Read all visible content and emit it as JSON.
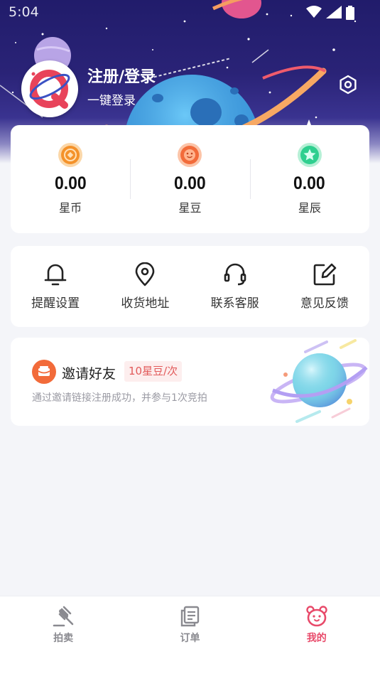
{
  "status_bar": {
    "time": "5:04"
  },
  "profile": {
    "title": "注册/登录",
    "subtitle": "一键登录"
  },
  "stats": [
    {
      "value": "0.00",
      "label": "星币",
      "icon": "coin-icon"
    },
    {
      "value": "0.00",
      "label": "星豆",
      "icon": "bean-icon"
    },
    {
      "value": "0.00",
      "label": "星辰",
      "icon": "star-icon"
    }
  ],
  "tools": [
    {
      "label": "提醒设置",
      "icon": "bell-icon"
    },
    {
      "label": "收货地址",
      "icon": "location-pin-icon"
    },
    {
      "label": "联系客服",
      "icon": "headset-icon"
    },
    {
      "label": "意见反馈",
      "icon": "edit-icon"
    }
  ],
  "invite": {
    "title": "邀请好友",
    "badge": "10星豆/次",
    "description": "通过邀请链接注册成功，并参与1次竞拍"
  },
  "bottom_nav": [
    {
      "label": "拍卖",
      "icon": "gavel-icon",
      "active": false
    },
    {
      "label": "订单",
      "icon": "document-icon",
      "active": false
    },
    {
      "label": "我的",
      "icon": "bear-icon",
      "active": true
    }
  ],
  "colors": {
    "accent": "#e84a6a",
    "banner_dark": "#211c6b",
    "coin": "#f4922a",
    "bean": "#f26b3a",
    "star": "#2fcf8f",
    "invite_badge_bg": "#fdeeee",
    "invite_badge_text": "#e25a5a"
  }
}
